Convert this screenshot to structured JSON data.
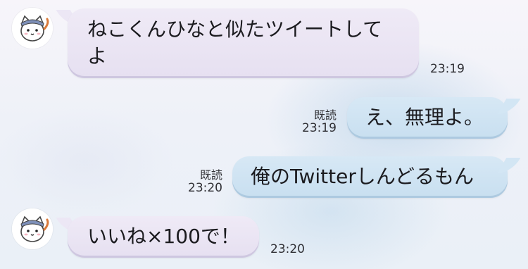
{
  "chat": {
    "messages": [
      {
        "direction": "incoming",
        "text": "ねこくんひなと似たツイートして",
        "text_line2": "よ",
        "time": "23:19"
      },
      {
        "direction": "outgoing",
        "text": "え、無理よ。",
        "read_label": "既読",
        "time": "23:19"
      },
      {
        "direction": "outgoing",
        "text": "俺のTwitterしんどるもん",
        "read_label": "既読",
        "time": "23:20"
      },
      {
        "direction": "incoming",
        "text": "いいね×100で！",
        "time": "23:20"
      }
    ]
  },
  "colors": {
    "incoming_bubble": "#e9e4f3",
    "outgoing_bubble": "#cfe3f2",
    "background": "#eef1f8"
  },
  "icons": {
    "avatar": "cat-character-avatar-icon"
  }
}
